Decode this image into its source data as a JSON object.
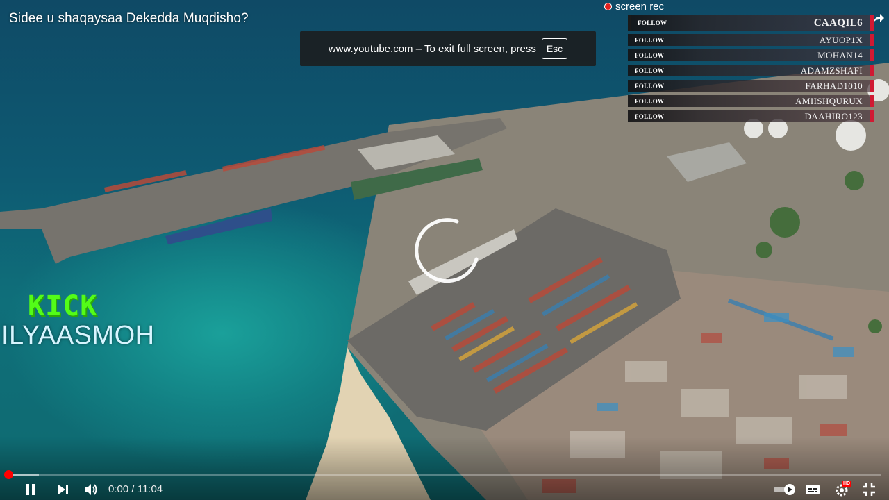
{
  "video": {
    "title": "Sidee u shaqaysaa Dekedda Muqdisho?",
    "current_time": "0:00",
    "duration": "11:04",
    "time_separator": "/",
    "progress_fraction": 0.0,
    "buffered_fraction": 0.035
  },
  "fullscreen_toast": {
    "message": "www.youtube.com – To exit full screen, press",
    "key": "Esc"
  },
  "screenrec": {
    "label": "screen rec"
  },
  "follow_overlay": {
    "rows": [
      {
        "label": "FOLLOW",
        "name": "CAAQIL6"
      },
      {
        "label": "FOLLOW",
        "name": "AYUOP1X"
      },
      {
        "label": "FOLLOW",
        "name": "MOHAN14"
      },
      {
        "label": "FOLLOW",
        "name": "ADAMZSHAFI"
      },
      {
        "label": "FOLLOW",
        "name": "FARHAD1010"
      },
      {
        "label": "FOLLOW",
        "name": "AMIISHQURUX"
      },
      {
        "label": "FOLLOW",
        "name": "DAAHIRO123"
      }
    ],
    "accent_color": "#d01a33"
  },
  "kick_overlay": {
    "logo_text": "KICK",
    "username": "ILYAASMOH",
    "logo_color": "#53fc18"
  },
  "controls": {
    "pause_icon": "pause-icon",
    "next_icon": "next-icon",
    "volume_icon": "volume-icon",
    "autoplay_icon": "autoplay-toggle-icon",
    "subtitles_icon": "subtitles-icon",
    "settings_icon": "settings-gear-icon",
    "settings_badge": "HD",
    "exit_fullscreen_icon": "exit-fullscreen-icon"
  },
  "colors": {
    "progress_played": "#ff0000",
    "badge_red": "#e0201e"
  }
}
